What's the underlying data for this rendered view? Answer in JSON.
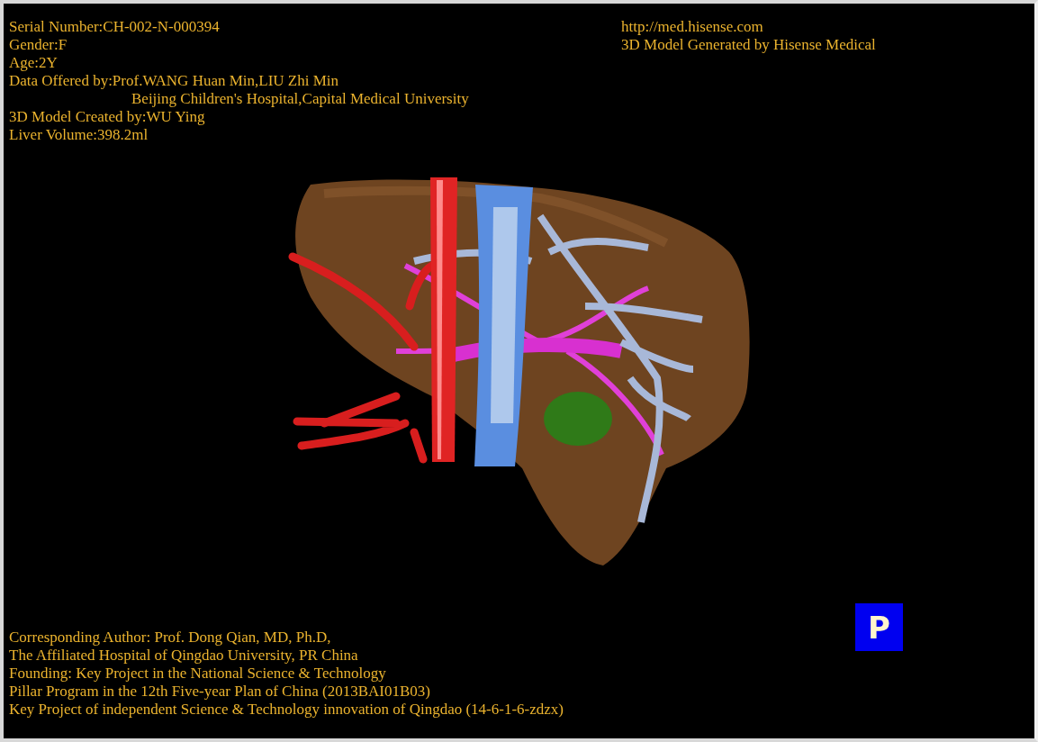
{
  "header_left": [
    {
      "text": "Serial Number:CH-002-N-000394",
      "kind": "line"
    },
    {
      "text": "Gender:F",
      "kind": "line"
    },
    {
      "text": "Age:2Y",
      "kind": "line"
    },
    {
      "text": "Data Offered by:Prof.WANG Huan Min,LIU Zhi Min",
      "kind": "line"
    },
    {
      "text": "Beijing Children's Hospital,Capital Medical University",
      "kind": "continuation"
    },
    {
      "text": "3D Model Created by:WU Ying",
      "kind": "line"
    },
    {
      "text": "Liver Volume:398.2ml",
      "kind": "line"
    }
  ],
  "header_right": [
    "http://med.hisense.com",
    "3D Model Generated by Hisense Medical"
  ],
  "footer_lines": [
    "Corresponding Author: Prof. Dong Qian, MD, Ph.D,",
    "The Affiliated Hospital of Qingdao University, PR China",
    "Founding: Key Project in the National Science & Technology",
    "Pillar Program in the 12th Five-year Plan of China (2013BAI01B03)",
    "Key Project of independent Science & Technology innovation of Qingdao (14-6-1-6-zdzx)"
  ],
  "projection_button": {
    "label": "P"
  }
}
